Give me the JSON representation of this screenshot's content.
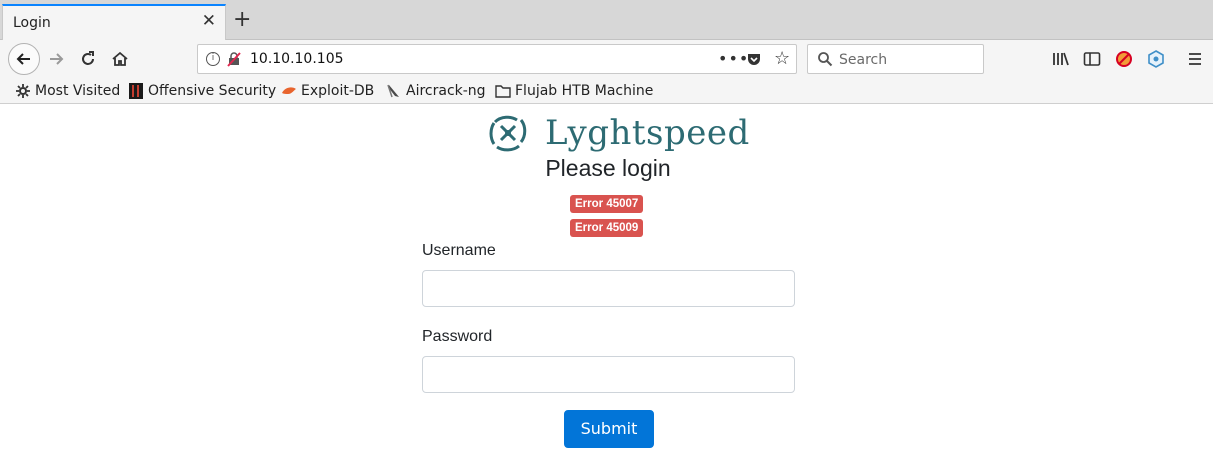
{
  "browser": {
    "tab_title": "Login",
    "url": "10.10.10.105",
    "search_placeholder": "Search",
    "bookmarks": [
      {
        "label": "Most Visited",
        "icon": "gear-icon"
      },
      {
        "label": "Offensive Security",
        "icon": "offsec-icon"
      },
      {
        "label": "Exploit-DB",
        "icon": "exploitdb-icon"
      },
      {
        "label": "Aircrack-ng",
        "icon": "aircrack-icon"
      },
      {
        "label": "Flujab HTB Machine",
        "icon": "folder-icon"
      }
    ]
  },
  "page": {
    "brand": "Lyghtspeed",
    "heading": "Please login",
    "errors": [
      "Error 45007",
      "Error 45009"
    ],
    "username_label": "Username",
    "username_value": "",
    "password_label": "Password",
    "password_value": "",
    "submit_label": "Submit"
  },
  "colors": {
    "brand": "#2d6b73",
    "error_badge": "#d9534f",
    "primary_button": "#0275d8",
    "tab_accent": "#0a84ff"
  }
}
